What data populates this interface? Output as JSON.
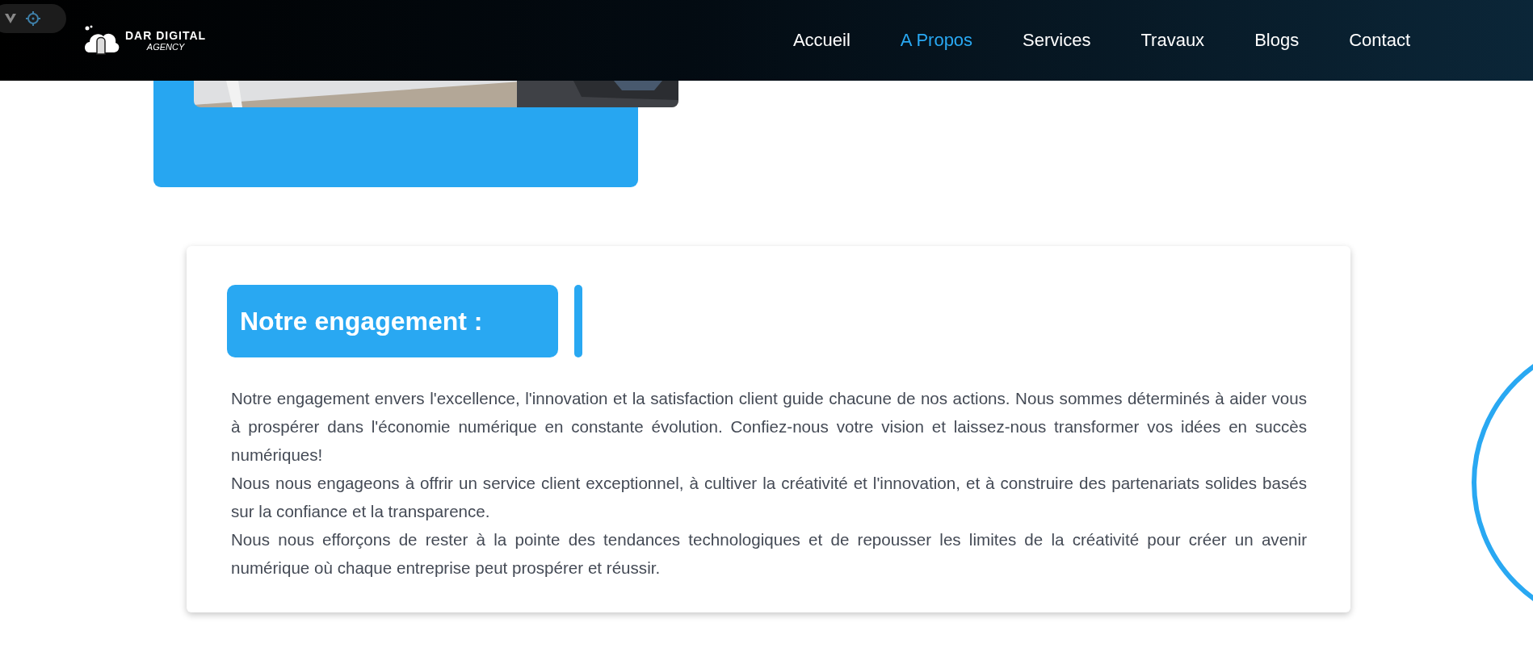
{
  "logo": {
    "line_1": "DAR DIGITAL",
    "line_2": "AGENCY"
  },
  "nav": [
    {
      "label": "Accueil",
      "selected": false
    },
    {
      "label": "A Propos",
      "selected": true
    },
    {
      "label": "Services",
      "selected": false
    },
    {
      "label": "Travaux",
      "selected": false
    },
    {
      "label": "Blogs",
      "selected": false
    },
    {
      "label": "Contact",
      "selected": false
    }
  ],
  "engagement": {
    "title": "Notre engagement :",
    "paragraphs": [
      "Notre engagement envers l'excellence, l'innovation et la satisfaction client guide chacune de nos actions. Nous sommes déterminés à aider vous à prospérer dans l'économie numérique en constante évolution. Confiez-nous votre vision et laissez-nous transformer vos idées en succès numériques!",
      "Nous nous engageons à offrir un service client exceptionnel, à cultiver la créativité et l'innovation, et à construire des partenariats solides basés sur la confiance et la transparence.",
      "Nous nous efforçons de rester à la pointe des tendances technologiques et de repousser les limites de la créativité pour créer un avenir numérique où chaque entreprise peut prospérer et réussir."
    ]
  }
}
